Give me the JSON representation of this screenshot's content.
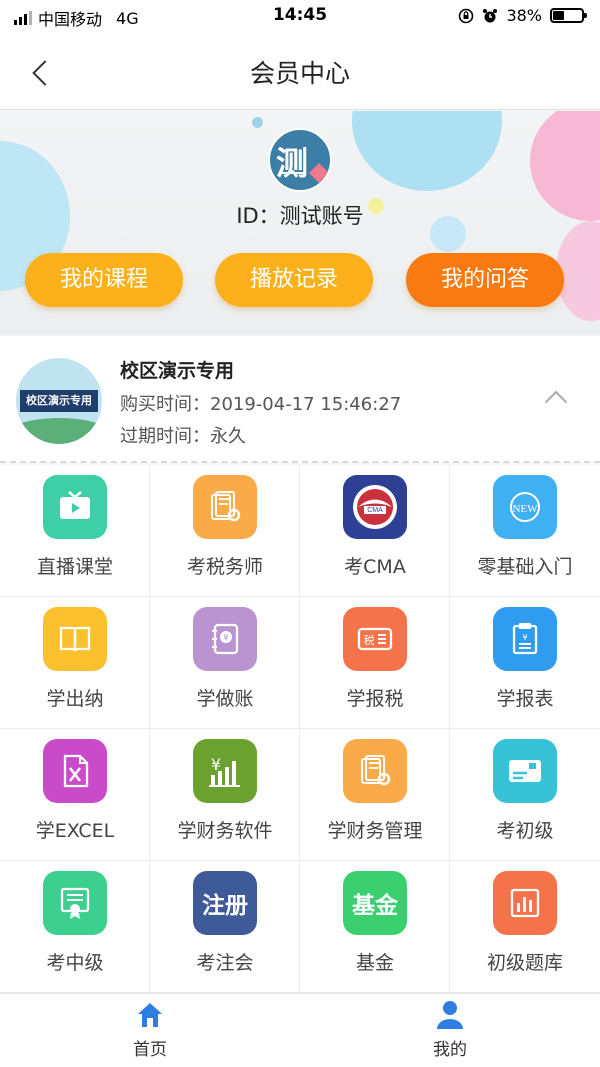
{
  "status_bar": {
    "carrier": "中国移动",
    "network": "4G",
    "time": "14:45",
    "battery_percent": "38%",
    "battery_level": 0.38
  },
  "nav": {
    "title": "会员中心",
    "back_icon": "chevron-left-icon"
  },
  "profile": {
    "avatar_text": "测",
    "id_label": "ID：测试账号",
    "buttons": [
      {
        "label": "我的课程",
        "color": "#fbb01c"
      },
      {
        "label": "播放记录",
        "color": "#fbb01c"
      },
      {
        "label": "我的问答",
        "color": "#f97a10"
      }
    ]
  },
  "course": {
    "thumb_text": "校区演示专用",
    "name": "校区演示专用",
    "purchase_time": "购买时间：2019-04-17 15:46:27",
    "expire_time": "过期时间：永久"
  },
  "grid": [
    {
      "label": "直播课堂",
      "icon": "tv-icon",
      "color": "#3ecfa7"
    },
    {
      "label": "考税务师",
      "icon": "document-gear-icon",
      "color": "#fbaa4a"
    },
    {
      "label": "考CMA",
      "icon": "cma-badge-icon",
      "color": "#2e3f96"
    },
    {
      "label": "零基础入门",
      "icon": "new-badge-icon",
      "color": "#3fb1f2"
    },
    {
      "label": "学出纳",
      "icon": "book-icon",
      "color": "#fbc02d"
    },
    {
      "label": "学做账",
      "icon": "yuan-notebook-icon",
      "color": "#b994d1"
    },
    {
      "label": "学报税",
      "icon": "tax-ticket-icon",
      "color": "#f4734a"
    },
    {
      "label": "学报表",
      "icon": "report-clipboard-icon",
      "color": "#2f9cf0"
    },
    {
      "label": "学EXCEL",
      "icon": "excel-icon",
      "color": "#c94bc9"
    },
    {
      "label": "学财务软件",
      "icon": "yuan-chart-icon",
      "color": "#6aa12f"
    },
    {
      "label": "学财务管理",
      "icon": "document-gear-icon",
      "color": "#fbaa4a"
    },
    {
      "label": "考初级",
      "icon": "card-icon",
      "color": "#37c2d6"
    },
    {
      "label": "考中级",
      "icon": "certificate-icon",
      "color": "#3ccf8e"
    },
    {
      "label": "考注会",
      "icon": "zhuce-text-icon",
      "icon_text": "注册",
      "color": "#3e5a99"
    },
    {
      "label": "基金",
      "icon": "jijin-text-icon",
      "icon_text": "基金",
      "color": "#3ccf6f"
    },
    {
      "label": "初级题库",
      "icon": "bar-chart-icon",
      "color": "#f4734a"
    }
  ],
  "tabbar": [
    {
      "label": "首页",
      "icon": "home-icon",
      "color": "#2f7de1",
      "active": true
    },
    {
      "label": "我的",
      "icon": "user-icon",
      "color": "#2f7de1",
      "active": false
    }
  ]
}
